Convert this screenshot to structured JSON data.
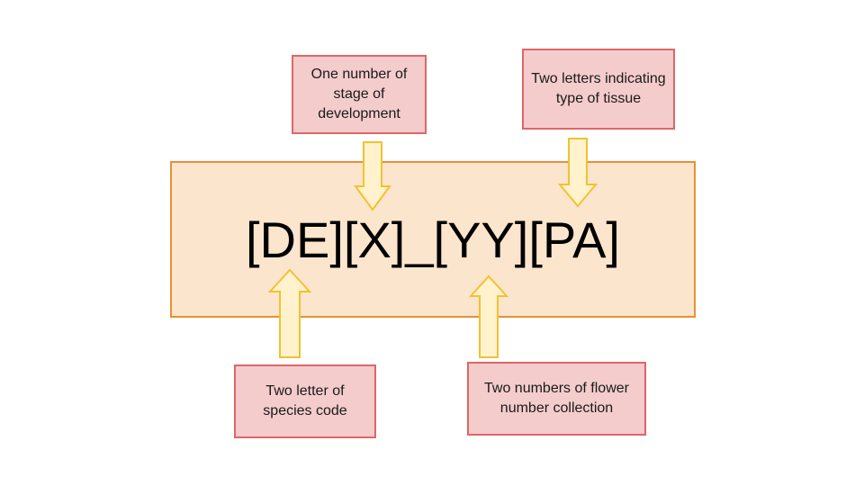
{
  "code_text": "[DE][X]_[YY][PA]",
  "labels": {
    "stage": "One number of stage of development",
    "tissue": "Two letters indicating type of tissue",
    "species": "Two letter of species code",
    "flower": "Two numbers of flower number collection"
  },
  "colors": {
    "main_fill": "#fce5cd",
    "main_border": "#e69138",
    "label_fill": "#f4cccc",
    "label_border": "#e06666",
    "arrow_fill": "#fff2cc",
    "arrow_border": "#f1c232"
  }
}
